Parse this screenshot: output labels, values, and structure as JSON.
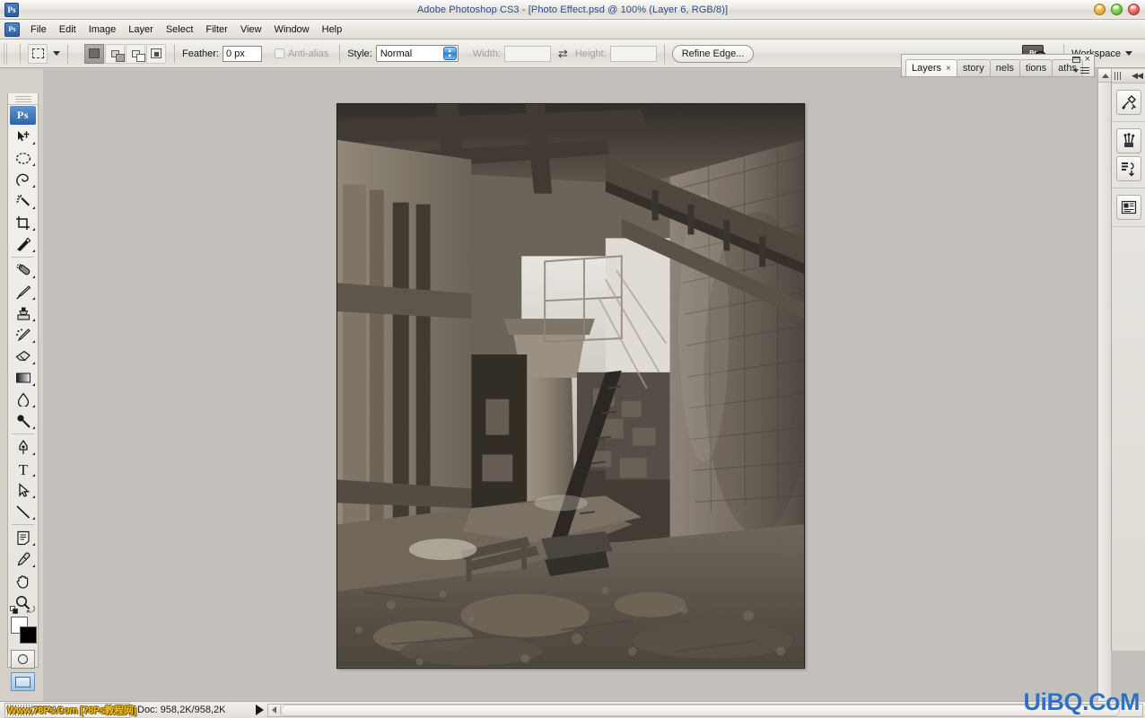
{
  "window": {
    "title": "Adobe Photoshop CS3 - [Photo Effect.psd @ 100% (Layer 6, RGB/8)]",
    "app_badge": "Ps",
    "controls": {
      "minimize": "minimize",
      "maximize": "maximize",
      "close": "close"
    }
  },
  "menubar": {
    "app_icon": "Ps",
    "items": [
      {
        "label": "File"
      },
      {
        "label": "Edit"
      },
      {
        "label": "Image"
      },
      {
        "label": "Layer"
      },
      {
        "label": "Select"
      },
      {
        "label": "Filter"
      },
      {
        "label": "View"
      },
      {
        "label": "Window"
      },
      {
        "label": "Help"
      }
    ]
  },
  "options_bar": {
    "tool_preset": "rectangular-marquee",
    "selection_modes": [
      {
        "name": "new-selection",
        "active": true
      },
      {
        "name": "add-to-selection",
        "active": false
      },
      {
        "name": "subtract-from-selection",
        "active": false
      },
      {
        "name": "intersect-with-selection",
        "active": false
      }
    ],
    "feather_label": "Feather:",
    "feather_value": "0 px",
    "antialias_label": "Anti-alias",
    "antialias_enabled": false,
    "style_label": "Style:",
    "style_value": "Normal",
    "width_label": "Width:",
    "width_value": "",
    "height_label": "Height:",
    "height_value": "",
    "swap_icon": "⇄",
    "refine_edge_label": "Refine Edge...",
    "bridge_label": "Br",
    "workspace_label": "Workspace"
  },
  "toolbox": {
    "app_badge": "Ps",
    "tools": [
      {
        "name": "move-tool",
        "label": "Move"
      },
      {
        "name": "elliptical-marquee-tool",
        "label": "Elliptical Marquee"
      },
      {
        "name": "lasso-tool",
        "label": "Lasso"
      },
      {
        "name": "magic-wand-tool",
        "label": "Magic Wand"
      },
      {
        "name": "crop-tool",
        "label": "Crop"
      },
      {
        "name": "slice-tool",
        "label": "Slice"
      },
      {
        "name": "healing-brush-tool",
        "label": "Healing Brush"
      },
      {
        "name": "brush-tool",
        "label": "Brush"
      },
      {
        "name": "clone-stamp-tool",
        "label": "Clone Stamp"
      },
      {
        "name": "history-brush-tool",
        "label": "History Brush"
      },
      {
        "name": "eraser-tool",
        "label": "Eraser"
      },
      {
        "name": "gradient-tool",
        "label": "Gradient"
      },
      {
        "name": "blur-tool",
        "label": "Blur"
      },
      {
        "name": "dodge-tool",
        "label": "Dodge"
      },
      {
        "name": "pen-tool",
        "label": "Pen"
      },
      {
        "name": "type-tool",
        "label": "Horizontal Type"
      },
      {
        "name": "path-selection-tool",
        "label": "Path Selection"
      },
      {
        "name": "line-tool",
        "label": "Line"
      },
      {
        "name": "notes-tool",
        "label": "Notes"
      },
      {
        "name": "eyedropper-tool",
        "label": "Eyedropper"
      },
      {
        "name": "hand-tool",
        "label": "Hand"
      },
      {
        "name": "zoom-tool",
        "label": "Zoom"
      }
    ],
    "foreground_color": "#ffffff",
    "background_color": "#000000",
    "quick_mask_label": "Edit in Quick Mask Mode",
    "screen_mode_label": "Change Screen Mode"
  },
  "panels": {
    "tabs": [
      {
        "label": "Layers",
        "active": true,
        "closable": true
      },
      {
        "label": "story",
        "active": false,
        "closable": false
      },
      {
        "label": "nels",
        "active": false,
        "closable": false
      },
      {
        "label": "tions",
        "active": false,
        "closable": false
      },
      {
        "label": "aths",
        "active": false,
        "closable": false
      }
    ],
    "close_glyph": "×",
    "dock_buttons": [
      {
        "name": "tool-presets-icon"
      },
      {
        "name": "brushes-icon"
      },
      {
        "name": "clone-source-icon"
      },
      {
        "name": "layer-comps-icon"
      }
    ],
    "collapse_glyph": "◀◀"
  },
  "document": {
    "filename": "Photo Effect.psd",
    "zoom": "100%",
    "layer": "Layer 6",
    "mode": "RGB/8",
    "alt_text": "Derelict industrial factory interior with concrete pillars, steel beams, brick walls and rubble-covered floor"
  },
  "statusbar": {
    "zoom_value": "100%",
    "doc_info": "Doc: 958,2K/958,2K",
    "watermark": "Www.78Ps.Com [78Ps教程网]",
    "site_logo": "UiBQ.CoM"
  },
  "colors": {
    "chrome": "#e8e6e0",
    "title_text": "#2d4d86",
    "workspace_bg": "#c3c0bb",
    "accent_blue": "#2f6fc4",
    "watermark_gold": "#f2c018"
  }
}
